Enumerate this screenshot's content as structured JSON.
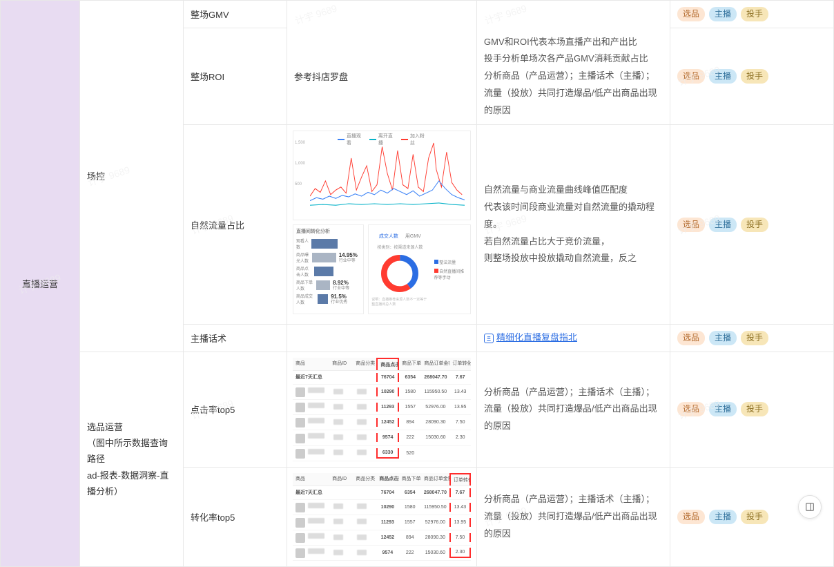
{
  "watermark": "计宇 9689",
  "col1": "直播运营",
  "sections": [
    {
      "col2": "场控",
      "rows": [
        {
          "c3": "整场GMV",
          "c4_span": true
        },
        {
          "c3": "整场ROI",
          "c4": "参考抖店罗盘",
          "c5": "GMV和ROI代表本场直播产出和产出比\n投手分析单场次各产品GMV消耗贡献占比\n分析商品（产品运营）；主播话术（主播）；\n流量（投放）共同打造爆品/低产出商品出现的原因"
        },
        {
          "c3": "自然流量占比",
          "thumb": "chart",
          "c5": "自然流量与商业流量曲线峰值匹配度\n代表该时间段商业流量对自然流量的撬动程度。\n若自然流量占比大于竞价流量，\n则整场投放中投放撬动自然流量，反之"
        },
        {
          "c3": "主播话术",
          "c4": "",
          "link": "精细化直播复盘指北"
        }
      ]
    },
    {
      "col2": "选品运营\n（图中所示数据查询路径\nad-报表-数据洞察-直播分析）",
      "rows": [
        {
          "c3": "点击率top5",
          "thumb": "table1",
          "c5": "分析商品（产品运营）；主播话术（主播）；\n流量（投放）共同打造爆品/低产出商品出现的原因"
        },
        {
          "c3": "转化率top5",
          "thumb": "table2",
          "c5": "分析商品（产品运营）；主播话术（主播）；\n流量（投放）共同打造爆品/低产出商品出现的原因"
        }
      ]
    }
  ],
  "tags": [
    "选品",
    "主播",
    "投手"
  ],
  "chart": {
    "legend": [
      "直播观看",
      "离开直播",
      "加入粉丝"
    ],
    "colors": [
      "#3b82f6",
      "#08b3c9",
      "#ff3b30"
    ],
    "yticks": [
      "1,500",
      "1,000",
      "500"
    ],
    "funnel_title": "直播间转化分析",
    "funnel_items": [
      "观看人数",
      "商品曝光人数",
      "商品点击人数",
      "商品下单人数",
      "商品成交人数"
    ],
    "funnel_stats": [
      {
        "pct": "14.95%",
        "sub": "行业中等"
      },
      {
        "pct": "8.92%",
        "sub": "行业中等"
      },
      {
        "pct": "91.5%",
        "sub": "行业优秀"
      }
    ],
    "donut_tabs": [
      "成交人数",
      "用GMV"
    ],
    "donut_sub": "按类别：按渠道来源人数",
    "donut_legend": [
      "整法流量",
      "自然直播间推荐等手动"
    ],
    "donut_values": [
      40,
      60
    ],
    "donut_foot": "说明：直播推荐来源人数不一定等于整直播间总人数"
  },
  "mini_header": [
    "商品",
    "商品ID",
    "商品分类",
    "商品点击数",
    "商品下单数",
    "商品订单金额",
    "订单转化率"
  ],
  "table1_highlight_col": 3,
  "table2_highlight_col": 6,
  "table_rows": [
    [
      "76704",
      "6354",
      "268047.70",
      "7.67"
    ],
    [
      "10290",
      "1580",
      "115950.50",
      "13.43"
    ],
    [
      "11293",
      "1557",
      "52976.00",
      "13.95"
    ],
    [
      "12452",
      "894",
      "28090.30",
      "7.50"
    ],
    [
      "9574",
      "222",
      "15030.60",
      "2.30"
    ],
    [
      "6330",
      "520",
      "",
      ""
    ]
  ],
  "table_sum_label": "最近7天汇总"
}
